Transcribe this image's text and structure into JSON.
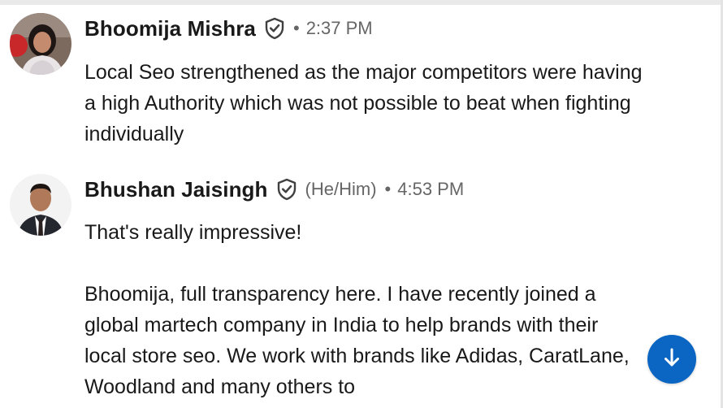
{
  "messages": [
    {
      "sender": "Bhoomija Mishra",
      "pronouns": "",
      "time": "2:37 PM",
      "paragraphs": [
        "Local Seo strengthened as the major competitors were having a high Authority which was not possible to beat when fighting individually"
      ]
    },
    {
      "sender": "Bhushan Jaisingh",
      "pronouns": "(He/Him)",
      "time": "4:53 PM",
      "paragraphs": [
        "That's really impressive!",
        "Bhoomija, full transparency here. I have recently joined a global martech company in India to help brands with their local store seo. We work with brands like Adidas, CaratLane, Woodland and many others to"
      ]
    }
  ],
  "separator": "•",
  "icons": {
    "verified": "verified-shield-icon",
    "scroll": "arrow-down-icon"
  },
  "colors": {
    "accent": "#0a66c2",
    "text": "#191919",
    "meta": "#666666"
  }
}
